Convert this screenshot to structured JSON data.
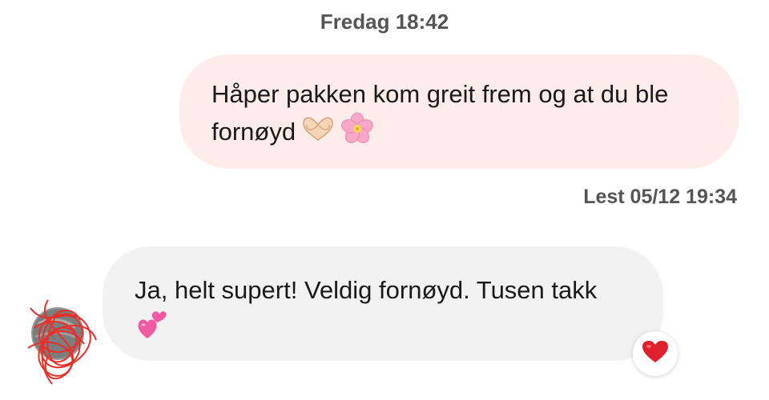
{
  "conversation": {
    "day_stamp": "Fredag 18:42",
    "outgoing": {
      "text_line1": "Håper pakken kom greit frem og at du ble",
      "text_line2": "fornøyd",
      "emojis": [
        "heart-hands",
        "cherry-blossom"
      ],
      "read_receipt": "Lest 05/12 19:34"
    },
    "incoming": {
      "text_line1": "Ja, helt supert! Veldig fornøyd. Tusen takk",
      "emoji": "two-hearts",
      "reaction": "red-heart"
    }
  },
  "colors": {
    "outgoing_bubble": "#fdece9",
    "incoming_bubble": "#f2f2f2",
    "meta_text": "#555555",
    "reaction_heart": "#e0202c"
  }
}
